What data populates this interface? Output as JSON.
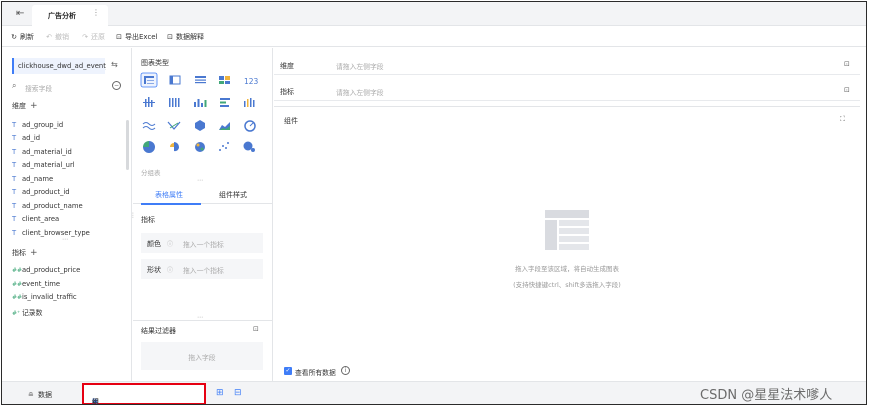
{
  "titlebar": {
    "tab_title": "广告分析",
    "more": "⋮"
  },
  "toolbar": {
    "refresh": "刷新",
    "undo": "撤销",
    "redo": "还原",
    "export": "导出Excel",
    "explain": "数据解释"
  },
  "left": {
    "dataset": "clickhouse_dwd_ad_event_...",
    "search_placeholder": "搜索字段",
    "dimensions_label": "维度",
    "dimensions": [
      "ad_group_id",
      "ad_id",
      "ad_material_id",
      "ad_material_url",
      "ad_name",
      "ad_product_id",
      "ad_product_name",
      "client_area",
      "client_browser_type"
    ],
    "metrics_label": "指标",
    "metrics": [
      "ad_product_price",
      "event_time",
      "is_invalid_traffic",
      "记录数"
    ]
  },
  "middle": {
    "chart_type_label": "图表类型",
    "group_label": "分组表",
    "tabs": [
      "表格属性",
      "组件样式"
    ],
    "metric_section": "指标",
    "color_label": "颜色",
    "shape_label": "形状",
    "drop_metric": "拖入一个指标",
    "filter_title": "结果过滤器",
    "filter_drop": "拖入字段",
    "numeric_icon": "123"
  },
  "right": {
    "dimension_shelf": "维度",
    "metric_shelf": "指标",
    "dimension_ph": "请拖入左侧字段",
    "metric_ph": "请拖入左侧字段",
    "widget_title": "组件",
    "tip_line1": "拖入字段至该区域，将自动生成图表",
    "tip_line2": "(支持快捷键ctrl、shift多选拖入字段)",
    "view_all": "查看所有数据"
  },
  "bottom": {
    "data_tab": "数据",
    "widget_tab": "组件"
  },
  "watermark": "CSDN @星星法术嗲人",
  "colors": {
    "accent": "#3f7df7",
    "highlight_border": "#e60012"
  }
}
